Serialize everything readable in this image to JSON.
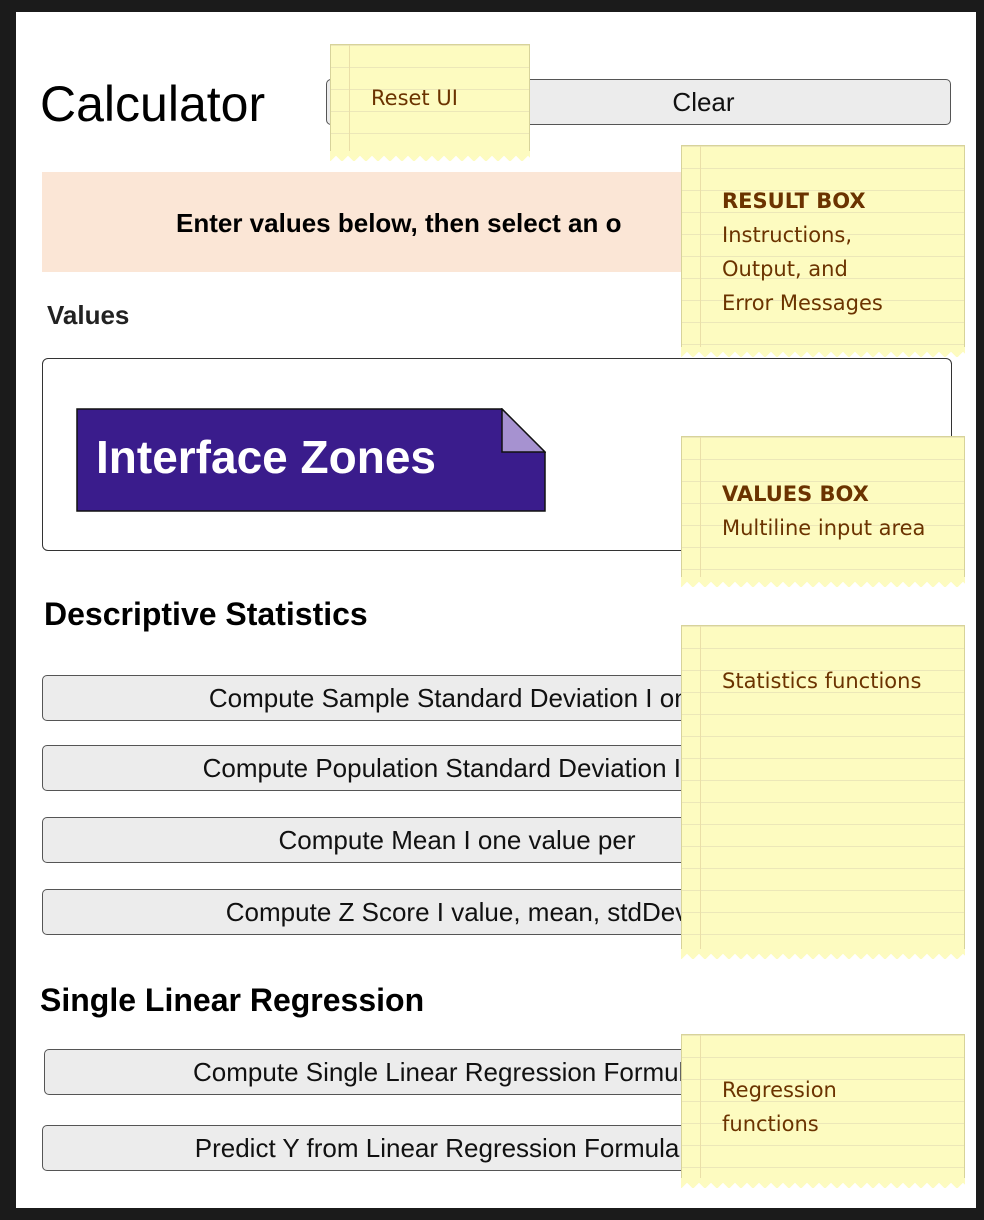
{
  "header": {
    "title": "Calculator",
    "clear_label": "Clear"
  },
  "result": {
    "instructions": "Enter values below, then select an o"
  },
  "values": {
    "label": "Values"
  },
  "zones_banner": {
    "label": "Interface Zones"
  },
  "stats": {
    "heading": "Descriptive Statistics",
    "buttons": [
      "Compute Sample Standard Deviation  I  one",
      "Compute Population Standard Deviation  I  or",
      "Compute Mean  I  one value per",
      "Compute Z Score  I  value, mean, stdDev"
    ]
  },
  "regression": {
    "heading": "Single Linear Regression",
    "buttons": [
      "Compute Single Linear Regression Formula  I o",
      "Predict Y from Linear Regression Formula  I  x,"
    ]
  },
  "notes": {
    "reset": "Reset UI",
    "result_title": "RESULT BOX",
    "result_lines": [
      "Instructions,",
      "Output, and",
      "Error Messages"
    ],
    "values_title": "VALUES BOX",
    "values_line": "Multiline input area",
    "stats_text": "Statistics functions",
    "regression_lines": [
      "Regression",
      "functions"
    ]
  },
  "colors": {
    "result_bg": "#fbe6d6",
    "button_bg": "#ececec",
    "banner_bg": "#3a1c8c",
    "note_bg": "#fdfbc0",
    "note_text": "#6b3300"
  }
}
